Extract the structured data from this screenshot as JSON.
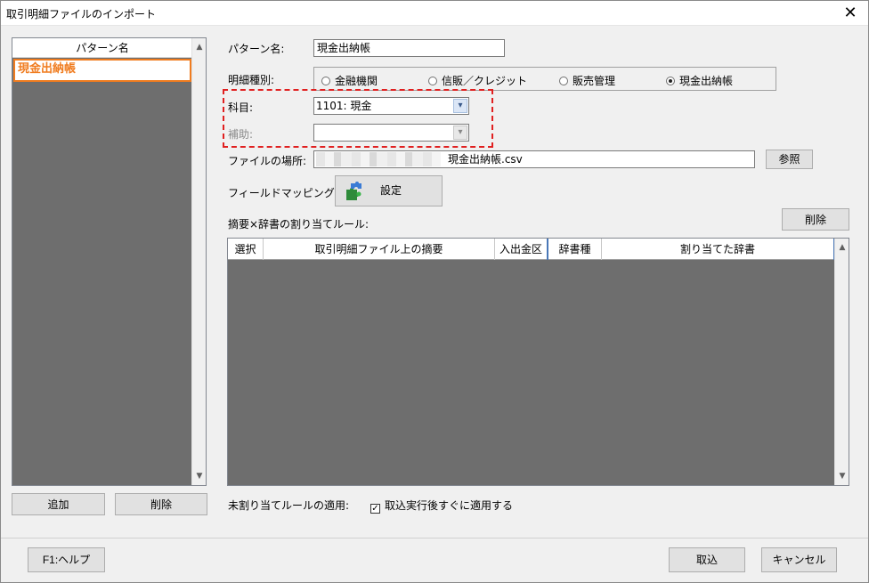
{
  "window": {
    "title": "取引明細ファイルのインポート",
    "close_glyph": "✕"
  },
  "pattern_list": {
    "header": "パターン名",
    "items": [
      {
        "label": "現金出納帳",
        "selected": true
      }
    ],
    "up_arrow": "▲",
    "down_arrow": "▼",
    "add_label": "追加",
    "delete_label": "削除"
  },
  "form": {
    "pattern_name_label": "パターン名:",
    "pattern_name_value": "現金出納帳",
    "detail_type_label": "明細種別:",
    "detail_type_options": [
      {
        "label": "金融機関",
        "checked": false
      },
      {
        "label": "信販／クレジット",
        "checked": false
      },
      {
        "label": "販売管理",
        "checked": false
      },
      {
        "label": "現金出納帳",
        "checked": true
      }
    ],
    "account_label": "科目:",
    "account_value": "1101: 現金",
    "sub_account_label": "補助:",
    "sub_account_value": "",
    "file_location_label": "ファイルの場所:",
    "file_name_value": "現金出納帳.csv",
    "browse_label": "参照",
    "field_mapping_label": "フィールドマッピング:",
    "settings_label": "設定",
    "rules_label": "摘要×辞書の割り当てルール:",
    "rules_delete_label": "削除",
    "dropdown_glyph": "▾"
  },
  "rules_table": {
    "columns": [
      "選択",
      "取引明細ファイル上の摘要",
      "入出金区",
      "辞書種",
      "割り当てた辞書"
    ],
    "rows": []
  },
  "unassigned": {
    "label": "未割り当てルールの適用:",
    "checkbox_label": "取込実行後すぐに適用する",
    "checked": true,
    "check_glyph": "✓"
  },
  "footer": {
    "help_label": "F1:ヘルプ",
    "import_label": "取込",
    "cancel_label": "キャンセル"
  },
  "colors": {
    "selection_orange": "#f07c1f",
    "highlight_red": "#e02020",
    "empty_area": "#6e6e6e"
  }
}
